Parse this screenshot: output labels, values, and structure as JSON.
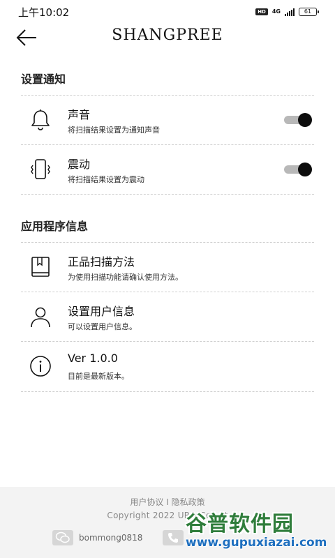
{
  "status_bar": {
    "time": "上午10:02",
    "hd": "HD",
    "network": "4G",
    "battery": "61"
  },
  "header": {
    "brand": "SHANGPREE",
    "back_icon": "arrow-left-icon"
  },
  "notification_section": {
    "title": "设置通知",
    "items": [
      {
        "icon": "bell-icon",
        "title": "声音",
        "subtitle": "将扫描结果设置为通知声音",
        "toggle_on": true
      },
      {
        "icon": "phone-vibrate-icon",
        "title": "震动",
        "subtitle": "将扫描结果设置为震动",
        "toggle_on": true
      }
    ]
  },
  "app_info_section": {
    "title": "应用程序信息",
    "items": [
      {
        "icon": "book-icon",
        "title": "正品扫描方法",
        "subtitle": "为使用扫描功能请确认使用方法。"
      },
      {
        "icon": "user-icon",
        "title": "设置用户信息",
        "subtitle": "可以设置用户信息。"
      },
      {
        "icon": "info-icon",
        "title": "Ver 1.0.0",
        "subtitle": "目前是最新版本。"
      }
    ]
  },
  "footer": {
    "user_agreement": "用户协议",
    "separator": "I",
    "privacy_policy": "隐私政策",
    "copyright": "Copyright 2022 URG Co., Lt",
    "wechat_id": "bommong0818",
    "wechat_icon": "wechat-icon",
    "phone_icon": "phone-icon"
  },
  "watermark": {
    "text": "谷普软件园",
    "url": "www.gupuxiazai.com"
  },
  "colors": {
    "toggle_track": "#b8b8b8",
    "toggle_knob": "#0d0d0d",
    "divider": "#cfcfcf",
    "footer_bg": "#f3f3f3",
    "watermark_green": "#2f7d3b",
    "watermark_blue": "#1e6fbf"
  }
}
